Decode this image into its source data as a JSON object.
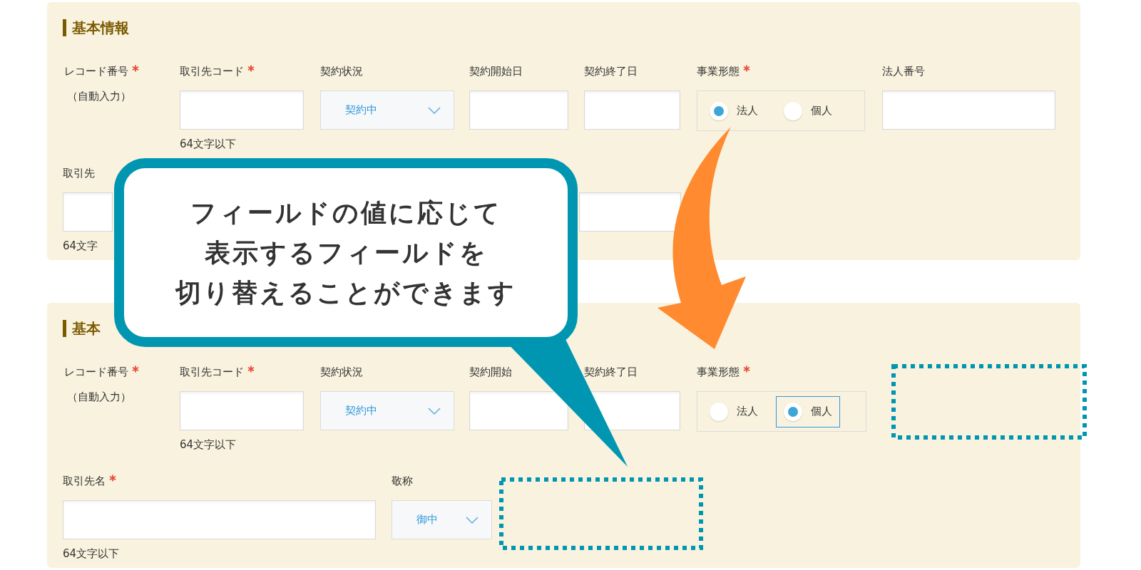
{
  "panels": [
    {
      "title": "基本情報",
      "rows": [
        [
          {
            "kind": "auto",
            "label": "レコード番号",
            "required": true,
            "note": "（自動入力）"
          },
          {
            "kind": "text",
            "label": "取引先コード",
            "required": true,
            "note": "64文字以下"
          },
          {
            "kind": "select",
            "label": "契約状況",
            "required": false,
            "value": "契約中"
          },
          {
            "kind": "text",
            "label": "契約開始日",
            "required": false
          },
          {
            "kind": "text",
            "label": "契約終了日",
            "required": false
          },
          {
            "kind": "radio",
            "label": "事業形態",
            "required": true,
            "options": [
              {
                "label": "法人",
                "selected": true,
                "focused": false
              },
              {
                "label": "個人",
                "selected": false,
                "focused": false
              }
            ]
          },
          {
            "kind": "text",
            "label": "法人番号",
            "required": false
          }
        ],
        [
          {
            "kind": "text",
            "label": "取引先",
            "required": false,
            "note": "64文字"
          },
          {
            "kind": "text"
          }
        ]
      ]
    },
    {
      "title": "基本",
      "rows": [
        [
          {
            "kind": "auto",
            "label": "レコード番号",
            "required": true,
            "note": "（自動入力）"
          },
          {
            "kind": "text",
            "label": "取引先コード",
            "required": true,
            "note": "64文字以下"
          },
          {
            "kind": "select",
            "label": "契約状況",
            "required": false,
            "value": "契約中"
          },
          {
            "kind": "text",
            "label": "契約開始",
            "required": false
          },
          {
            "kind": "text",
            "label": "契約終了日",
            "required": false
          },
          {
            "kind": "radio",
            "label": "事業形態",
            "required": true,
            "options": [
              {
                "label": "法人",
                "selected": false,
                "focused": false
              },
              {
                "label": "個人",
                "selected": true,
                "focused": true
              }
            ]
          }
        ],
        [
          {
            "kind": "text",
            "label": "取引先名",
            "required": true,
            "note": "64文字以下"
          },
          {
            "kind": "select",
            "label": "敬称",
            "required": false,
            "value": "御中"
          }
        ]
      ]
    }
  ],
  "callout": {
    "lines": [
      "フィールドの値に応じて",
      "表示するフィールドを",
      "切り替えることができます"
    ]
  }
}
